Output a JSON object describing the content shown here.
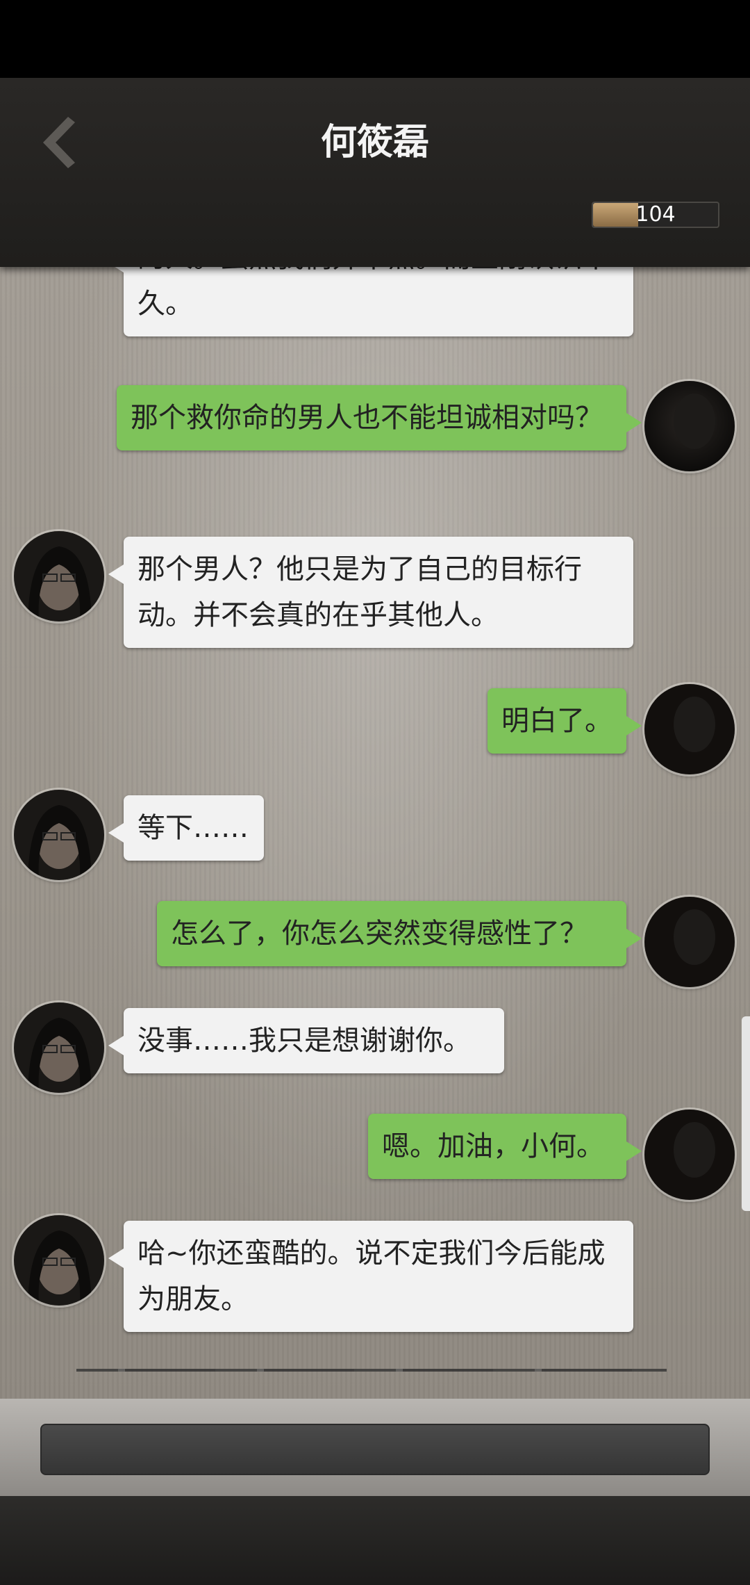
{
  "header": {
    "title": "何筱磊",
    "counter_value": "104",
    "counter_fill_fraction": 0.36,
    "back_icon": "chevron-left-icon"
  },
  "messages": [
    {
      "side": "left",
      "text": "的人。虽然我们并不熟。而且刚认识不久。"
    },
    {
      "side": "right",
      "text": "那个救你命的男人也不能坦诚相对吗？"
    },
    {
      "side": "left",
      "text": "那个男人？他只是为了自己的目标行动。并不会真的在乎其他人。"
    },
    {
      "side": "right",
      "text": "明白了。"
    },
    {
      "side": "left",
      "text": "等下……"
    },
    {
      "side": "right",
      "text": "怎么了，你怎么突然变得感性了？"
    },
    {
      "side": "left",
      "text": "没事……我只是想谢谢你。"
    },
    {
      "side": "right",
      "text": "嗯。加油，小何。"
    },
    {
      "side": "left",
      "text": "哈~你还蛮酷的。说不定我们今后能成为朋友。"
    }
  ],
  "colors": {
    "left_bubble": "#f2f2f2",
    "right_bubble": "#7ec35a",
    "header": "#2a2826"
  }
}
